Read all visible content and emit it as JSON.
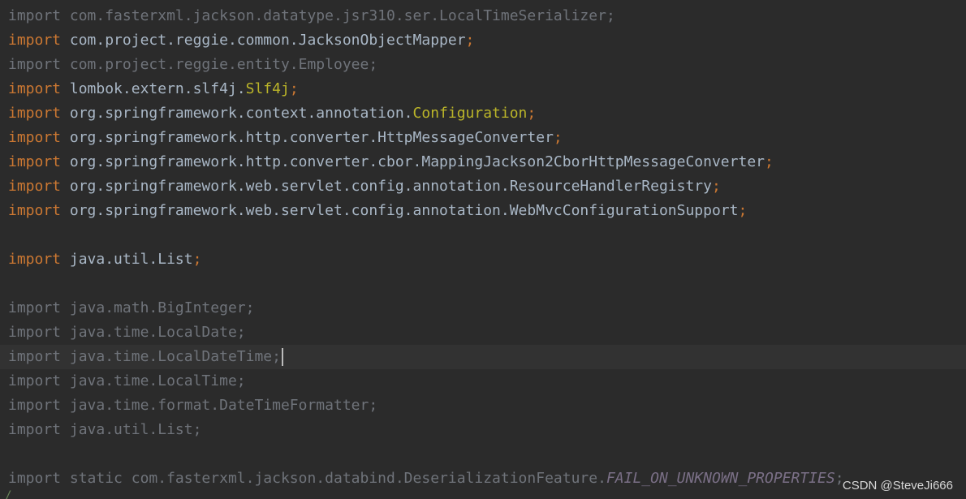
{
  "colors": {
    "background": "#2b2b2b",
    "keyword": "#cc7832",
    "text": "#a9b7c6",
    "unused_import": "#6f737a",
    "annotation": "#bbb529",
    "constant": "#9876aa",
    "current_line": "#323232"
  },
  "lines": [
    {
      "kw": "import",
      "path": "com.fasterxml.jackson.datatype.jsr310.ser.LocalTimeSerializer",
      "semi": ";"
    },
    {
      "kw": "import",
      "path": "com.project.reggie.common.JacksonObjectMapper",
      "semi": ";"
    },
    {
      "kw": "import",
      "path": "com.project.reggie.entity.Employee",
      "semi": ";"
    },
    {
      "kw": "import",
      "path": "lombok.extern.slf4j.",
      "ann": "Slf4j",
      "semi": ";"
    },
    {
      "kw": "import",
      "path": "org.springframework.context.annotation.",
      "ann": "Configuration",
      "semi": ";"
    },
    {
      "kw": "import",
      "path": "org.springframework.http.converter.HttpMessageConverter",
      "semi": ";"
    },
    {
      "kw": "import",
      "path": "org.springframework.http.converter.cbor.MappingJackson2CborHttpMessageConverter",
      "semi": ";"
    },
    {
      "kw": "import",
      "path": "org.springframework.web.servlet.config.annotation.ResourceHandlerRegistry",
      "semi": ";"
    },
    {
      "kw": "import",
      "path": "org.springframework.web.servlet.config.annotation.WebMvcConfigurationSupport",
      "semi": ";"
    },
    {
      "kw": "import",
      "path": "java.util.List",
      "semi": ";"
    },
    {
      "kw": "import",
      "path": "java.math.BigInteger",
      "semi": ";"
    },
    {
      "kw": "import",
      "path": "java.time.LocalDate",
      "semi": ";"
    },
    {
      "kw": "import",
      "path": "java.time.LocalDateTime",
      "semi": ";"
    },
    {
      "kw": "import",
      "path": "java.time.LocalTime",
      "semi": ";"
    },
    {
      "kw": "import",
      "path": "java.time.format.DateTimeFormatter",
      "semi": ";"
    },
    {
      "kw": "import",
      "path": "java.util.List",
      "semi": ";"
    },
    {
      "kw": "import static",
      "path": "com.fasterxml.jackson.databind.DeserializationFeature.",
      "const": "FAIL_ON_UNKNOWN_PROPERTIES",
      "semi": ";"
    }
  ],
  "partial_line": "/",
  "watermark": "CSDN @SteveJi666"
}
